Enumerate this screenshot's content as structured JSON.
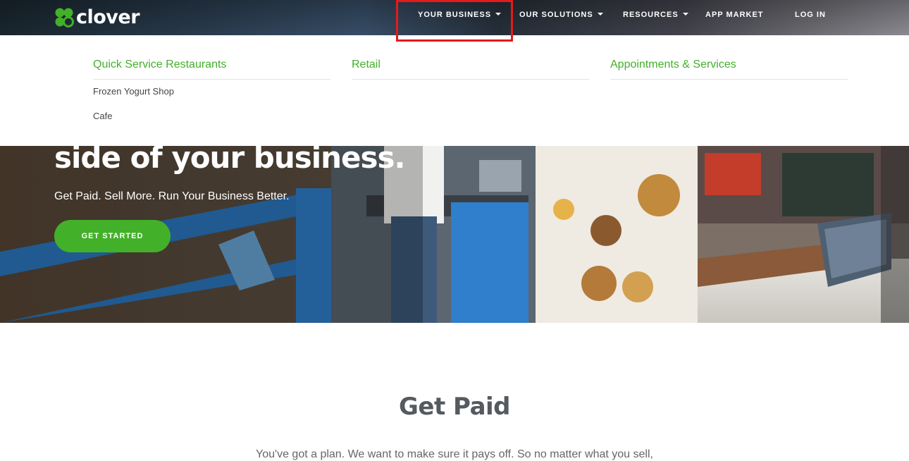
{
  "brand": {
    "name": "clover",
    "accent_color": "#43b02a",
    "logo_icon": "clover-leaf-icon"
  },
  "nav": {
    "items": [
      {
        "label": "YOUR BUSINESS",
        "has_dropdown": true,
        "active": true
      },
      {
        "label": "OUR SOLUTIONS",
        "has_dropdown": true
      },
      {
        "label": "RESOURCES",
        "has_dropdown": true
      },
      {
        "label": "APP MARKET",
        "has_dropdown": false
      },
      {
        "label": "LOG IN",
        "has_dropdown": false
      }
    ],
    "highlight_color": "#e31b1b"
  },
  "dropdown": {
    "columns": [
      {
        "heading": "Quick Service Restaurants",
        "links": [
          "Frozen Yogurt Shop",
          "Cafe"
        ]
      },
      {
        "heading": "Retail",
        "links": []
      },
      {
        "heading": "Appointments & Services",
        "links": []
      }
    ]
  },
  "hero": {
    "headline": "side of your business.",
    "subheadline": "Get Paid. Sell More. Run Your Business Better.",
    "cta_label": "GET STARTED"
  },
  "section": {
    "title": "Get Paid",
    "body": "You've got a plan. We want to make sure it pays off. So no matter what you sell,"
  }
}
